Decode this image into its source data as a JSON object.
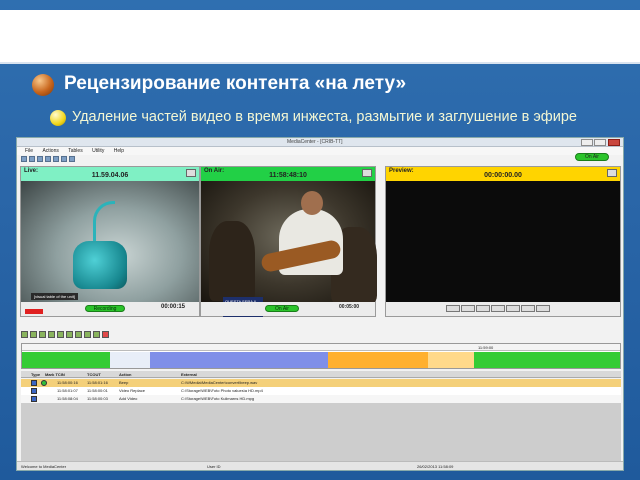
{
  "slide": {
    "heading": "Рецензирование контента «на лету»",
    "subheading": "Удаление частей видео в время инжеста, размытие и заглушение в эфире"
  },
  "app": {
    "title": "MediaCenter - [CRIB-TT]",
    "menu": [
      "File",
      "Actions",
      "Tables",
      "Utility",
      "Help"
    ],
    "on_air_button": "On Air",
    "live": {
      "label": "Live:",
      "timecode": "11.59.04.06",
      "record_label": "Recording",
      "footer_tc": "00:00:15",
      "caption": "[visual table of the unit]"
    },
    "onair": {
      "label": "On Air:",
      "timecode": "11:58:48:10",
      "footer_button": "On Air",
      "footer_tc": "00:05:00",
      "logo_text": "QUESTA SERA Il DOMANI"
    },
    "preview": {
      "label": "Preview:",
      "timecode": "00:00:00.00"
    },
    "timeline": {
      "marker": "11:59:00"
    },
    "table": {
      "headers": [
        "Type",
        "Mark TCIN",
        "TCOUT",
        "Action",
        "External"
      ],
      "rows": [
        {
          "tcin": "11:58:00:16",
          "tcout": "11:58:01:16",
          "action": "Beep",
          "external": "C:\\WMedia\\MediaCenter\\convert\\beep.wav",
          "color": "#f4d07a"
        },
        {
          "tcin": "11:58:01:07",
          "tcout": "11:58:00:01",
          "action": "Video Replace",
          "external": "C:\\Storage\\WEB\\Foto Photo values\\a HD.mp4",
          "color": "#ffffff"
        },
        {
          "tcin": "11:58:08:04",
          "tcout": "11:58:00:03",
          "action": "Add Video",
          "external": "C:\\Storage\\WEB\\Foto Kulimarns HD.mpg",
          "color": "#f6f6f6"
        }
      ]
    },
    "status": {
      "left": "Welcome to MediaCenter",
      "middle": "User ID",
      "right": "26/02/2013 11:58:09"
    }
  },
  "colors": {
    "live_header": "#7ff0c4",
    "onair_header": "#22d046",
    "preview_header": "#ffd400",
    "seg_green": "#35cc35",
    "seg_blue": "#7f8fe8",
    "seg_orange": "#ffb02e"
  }
}
